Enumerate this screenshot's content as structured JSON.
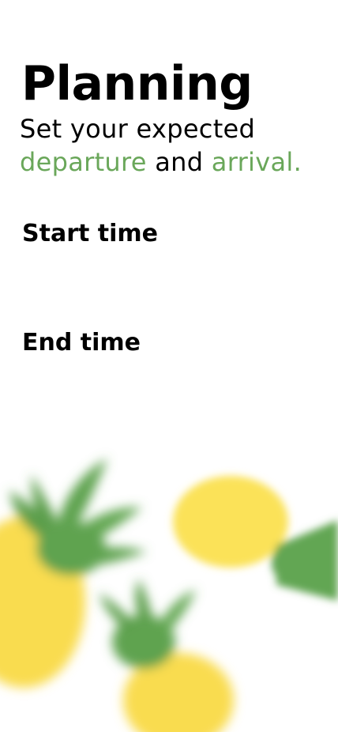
{
  "header": {
    "title": "Planning",
    "subtitle_line1": "Set your expected",
    "subtitle_departure": "departure",
    "subtitle_and": " and ",
    "subtitle_arrival": "arrival."
  },
  "form": {
    "start_label": "Start time",
    "end_label": "End time"
  },
  "decoration": {
    "icon": "pineapple-illustration"
  },
  "colors": {
    "accent": "#6aa75a",
    "leaf_green": "#5fa34f",
    "fruit_yellow": "#f9dc50",
    "text": "#000000",
    "background": "#ffffff"
  }
}
